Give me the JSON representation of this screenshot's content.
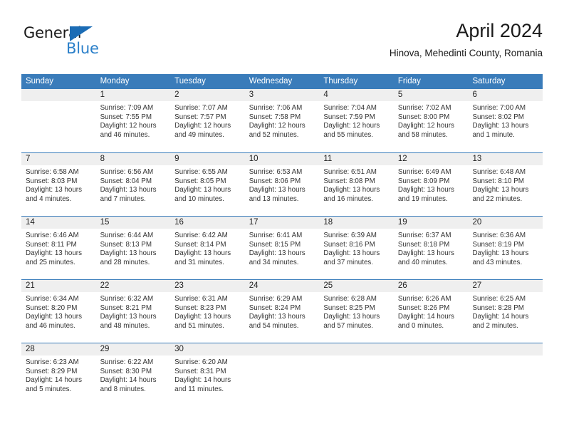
{
  "logo": {
    "name": "General Blue",
    "word_general": "General",
    "word_blue": "Blue",
    "triangle_color": "#1b6cb5",
    "blue_text_color": "#2a7fc9"
  },
  "header": {
    "title": "April 2024",
    "subtitle": "Hinova, Mehedinti County, Romania"
  },
  "theme": {
    "header_band_color": "#3a7cba",
    "day_band_color": "#efefef",
    "row_separator_color": "#3a7cba",
    "text_color": "#333333"
  },
  "weekdays": [
    "Sunday",
    "Monday",
    "Tuesday",
    "Wednesday",
    "Thursday",
    "Friday",
    "Saturday"
  ],
  "labels": {
    "sunrise": "Sunrise:",
    "sunset": "Sunset:",
    "daylight": "Daylight:"
  },
  "weeks": [
    [
      {
        "day": "",
        "empty": true
      },
      {
        "day": "1",
        "sunrise": "Sunrise: 7:09 AM",
        "sunset": "Sunset: 7:55 PM",
        "daylight_line1": "Daylight: 12 hours",
        "daylight_line2": "and 46 minutes."
      },
      {
        "day": "2",
        "sunrise": "Sunrise: 7:07 AM",
        "sunset": "Sunset: 7:57 PM",
        "daylight_line1": "Daylight: 12 hours",
        "daylight_line2": "and 49 minutes."
      },
      {
        "day": "3",
        "sunrise": "Sunrise: 7:06 AM",
        "sunset": "Sunset: 7:58 PM",
        "daylight_line1": "Daylight: 12 hours",
        "daylight_line2": "and 52 minutes."
      },
      {
        "day": "4",
        "sunrise": "Sunrise: 7:04 AM",
        "sunset": "Sunset: 7:59 PM",
        "daylight_line1": "Daylight: 12 hours",
        "daylight_line2": "and 55 minutes."
      },
      {
        "day": "5",
        "sunrise": "Sunrise: 7:02 AM",
        "sunset": "Sunset: 8:00 PM",
        "daylight_line1": "Daylight: 12 hours",
        "daylight_line2": "and 58 minutes."
      },
      {
        "day": "6",
        "sunrise": "Sunrise: 7:00 AM",
        "sunset": "Sunset: 8:02 PM",
        "daylight_line1": "Daylight: 13 hours",
        "daylight_line2": "and 1 minute."
      }
    ],
    [
      {
        "day": "7",
        "sunrise": "Sunrise: 6:58 AM",
        "sunset": "Sunset: 8:03 PM",
        "daylight_line1": "Daylight: 13 hours",
        "daylight_line2": "and 4 minutes."
      },
      {
        "day": "8",
        "sunrise": "Sunrise: 6:56 AM",
        "sunset": "Sunset: 8:04 PM",
        "daylight_line1": "Daylight: 13 hours",
        "daylight_line2": "and 7 minutes."
      },
      {
        "day": "9",
        "sunrise": "Sunrise: 6:55 AM",
        "sunset": "Sunset: 8:05 PM",
        "daylight_line1": "Daylight: 13 hours",
        "daylight_line2": "and 10 minutes."
      },
      {
        "day": "10",
        "sunrise": "Sunrise: 6:53 AM",
        "sunset": "Sunset: 8:06 PM",
        "daylight_line1": "Daylight: 13 hours",
        "daylight_line2": "and 13 minutes."
      },
      {
        "day": "11",
        "sunrise": "Sunrise: 6:51 AM",
        "sunset": "Sunset: 8:08 PM",
        "daylight_line1": "Daylight: 13 hours",
        "daylight_line2": "and 16 minutes."
      },
      {
        "day": "12",
        "sunrise": "Sunrise: 6:49 AM",
        "sunset": "Sunset: 8:09 PM",
        "daylight_line1": "Daylight: 13 hours",
        "daylight_line2": "and 19 minutes."
      },
      {
        "day": "13",
        "sunrise": "Sunrise: 6:48 AM",
        "sunset": "Sunset: 8:10 PM",
        "daylight_line1": "Daylight: 13 hours",
        "daylight_line2": "and 22 minutes."
      }
    ],
    [
      {
        "day": "14",
        "sunrise": "Sunrise: 6:46 AM",
        "sunset": "Sunset: 8:11 PM",
        "daylight_line1": "Daylight: 13 hours",
        "daylight_line2": "and 25 minutes."
      },
      {
        "day": "15",
        "sunrise": "Sunrise: 6:44 AM",
        "sunset": "Sunset: 8:13 PM",
        "daylight_line1": "Daylight: 13 hours",
        "daylight_line2": "and 28 minutes."
      },
      {
        "day": "16",
        "sunrise": "Sunrise: 6:42 AM",
        "sunset": "Sunset: 8:14 PM",
        "daylight_line1": "Daylight: 13 hours",
        "daylight_line2": "and 31 minutes."
      },
      {
        "day": "17",
        "sunrise": "Sunrise: 6:41 AM",
        "sunset": "Sunset: 8:15 PM",
        "daylight_line1": "Daylight: 13 hours",
        "daylight_line2": "and 34 minutes."
      },
      {
        "day": "18",
        "sunrise": "Sunrise: 6:39 AM",
        "sunset": "Sunset: 8:16 PM",
        "daylight_line1": "Daylight: 13 hours",
        "daylight_line2": "and 37 minutes."
      },
      {
        "day": "19",
        "sunrise": "Sunrise: 6:37 AM",
        "sunset": "Sunset: 8:18 PM",
        "daylight_line1": "Daylight: 13 hours",
        "daylight_line2": "and 40 minutes."
      },
      {
        "day": "20",
        "sunrise": "Sunrise: 6:36 AM",
        "sunset": "Sunset: 8:19 PM",
        "daylight_line1": "Daylight: 13 hours",
        "daylight_line2": "and 43 minutes."
      }
    ],
    [
      {
        "day": "21",
        "sunrise": "Sunrise: 6:34 AM",
        "sunset": "Sunset: 8:20 PM",
        "daylight_line1": "Daylight: 13 hours",
        "daylight_line2": "and 46 minutes."
      },
      {
        "day": "22",
        "sunrise": "Sunrise: 6:32 AM",
        "sunset": "Sunset: 8:21 PM",
        "daylight_line1": "Daylight: 13 hours",
        "daylight_line2": "and 48 minutes."
      },
      {
        "day": "23",
        "sunrise": "Sunrise: 6:31 AM",
        "sunset": "Sunset: 8:23 PM",
        "daylight_line1": "Daylight: 13 hours",
        "daylight_line2": "and 51 minutes."
      },
      {
        "day": "24",
        "sunrise": "Sunrise: 6:29 AM",
        "sunset": "Sunset: 8:24 PM",
        "daylight_line1": "Daylight: 13 hours",
        "daylight_line2": "and 54 minutes."
      },
      {
        "day": "25",
        "sunrise": "Sunrise: 6:28 AM",
        "sunset": "Sunset: 8:25 PM",
        "daylight_line1": "Daylight: 13 hours",
        "daylight_line2": "and 57 minutes."
      },
      {
        "day": "26",
        "sunrise": "Sunrise: 6:26 AM",
        "sunset": "Sunset: 8:26 PM",
        "daylight_line1": "Daylight: 14 hours",
        "daylight_line2": "and 0 minutes."
      },
      {
        "day": "27",
        "sunrise": "Sunrise: 6:25 AM",
        "sunset": "Sunset: 8:28 PM",
        "daylight_line1": "Daylight: 14 hours",
        "daylight_line2": "and 2 minutes."
      }
    ],
    [
      {
        "day": "28",
        "sunrise": "Sunrise: 6:23 AM",
        "sunset": "Sunset: 8:29 PM",
        "daylight_line1": "Daylight: 14 hours",
        "daylight_line2": "and 5 minutes."
      },
      {
        "day": "29",
        "sunrise": "Sunrise: 6:22 AM",
        "sunset": "Sunset: 8:30 PM",
        "daylight_line1": "Daylight: 14 hours",
        "daylight_line2": "and 8 minutes."
      },
      {
        "day": "30",
        "sunrise": "Sunrise: 6:20 AM",
        "sunset": "Sunset: 8:31 PM",
        "daylight_line1": "Daylight: 14 hours",
        "daylight_line2": "and 11 minutes."
      },
      {
        "day": "",
        "empty": true
      },
      {
        "day": "",
        "empty": true
      },
      {
        "day": "",
        "empty": true
      },
      {
        "day": "",
        "empty": true
      }
    ]
  ]
}
